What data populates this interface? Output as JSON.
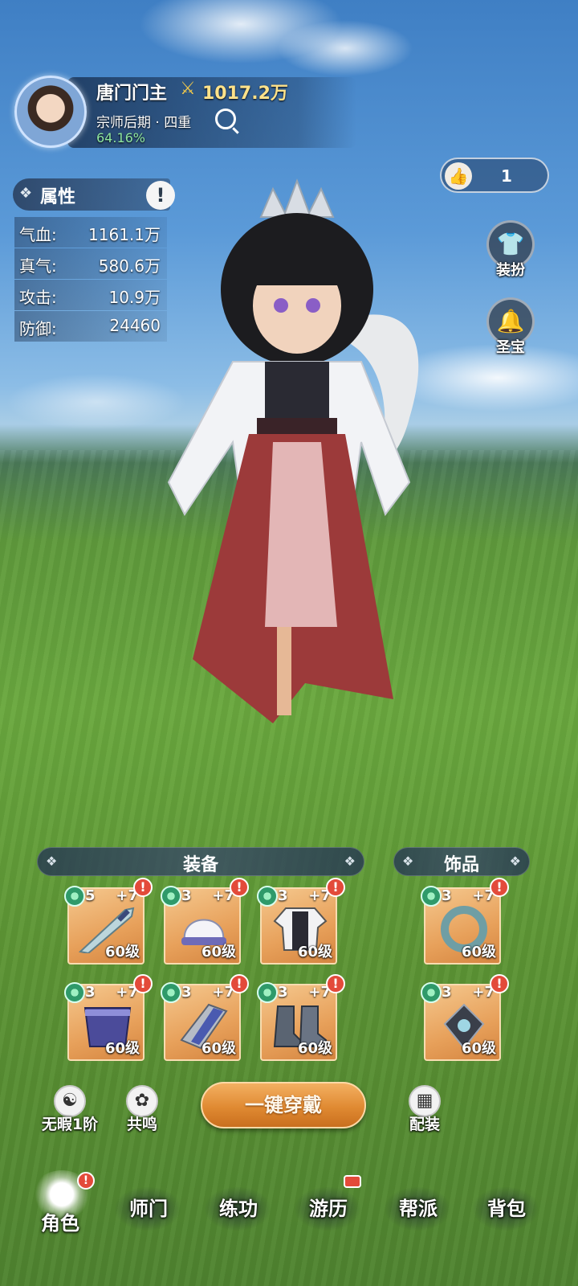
{
  "header": {
    "player_name": "唐门门主",
    "power_value": "1017.2万",
    "rank": "宗师后期 · 四重",
    "progress": "64.16%"
  },
  "like": {
    "count": "1"
  },
  "attributes": {
    "title": "属性",
    "info_glyph": "!",
    "rows": [
      {
        "label": "气血:",
        "value": "1161.1万"
      },
      {
        "label": "真气:",
        "value": "580.6万"
      },
      {
        "label": "攻击:",
        "value": "10.9万"
      },
      {
        "label": "防御:",
        "value": "24460"
      }
    ]
  },
  "side_buttons": [
    {
      "label": "装扮",
      "icon": "shirt-icon"
    },
    {
      "label": "圣宝",
      "icon": "bell-icon"
    }
  ],
  "equipment": {
    "title": "装备",
    "slots": [
      {
        "stars": "5",
        "plus": "+7",
        "level": "60级",
        "item": "sword-icon"
      },
      {
        "stars": "3",
        "plus": "+7",
        "level": "60级",
        "item": "helmet-icon"
      },
      {
        "stars": "3",
        "plus": "+7",
        "level": "60级",
        "item": "armor-icon"
      },
      {
        "stars": "3",
        "plus": "+7",
        "level": "60级",
        "item": "belt-icon"
      },
      {
        "stars": "3",
        "plus": "+7",
        "level": "60级",
        "item": "bracer-icon"
      },
      {
        "stars": "3",
        "plus": "+7",
        "level": "60级",
        "item": "boots-icon"
      }
    ]
  },
  "accessories": {
    "title": "饰品",
    "slots": [
      {
        "stars": "3",
        "plus": "+7",
        "level": "60级",
        "item": "ring-icon"
      },
      {
        "stars": "3",
        "plus": "+7",
        "level": "60级",
        "item": "amulet-icon"
      }
    ]
  },
  "actions": {
    "flawless": "无暇1阶",
    "resonance": "共鸣",
    "equip_all": "一键穿戴",
    "loadout": "配装"
  },
  "nav": [
    {
      "label": "角色",
      "active": true
    },
    {
      "label": "师门"
    },
    {
      "label": "练功"
    },
    {
      "label": "游历"
    },
    {
      "label": "帮派"
    },
    {
      "label": "背包"
    }
  ],
  "alert_glyph": "!",
  "colors": {
    "accent_orange": "#e08a32",
    "alert_red": "#e34a3a",
    "progress_green": "#8ee6a0",
    "power_gold": "#ffe28a"
  }
}
